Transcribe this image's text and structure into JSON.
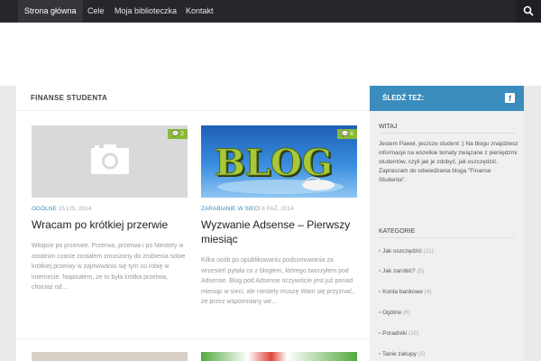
{
  "nav": {
    "items": [
      "Strona główna",
      "Cele",
      "Moja biblioteczka",
      "Kontakt"
    ]
  },
  "page": {
    "title": "FINANSE STUDENTA"
  },
  "posts": [
    {
      "category": "OGÓLNE",
      "date": "15 LIS, 2014",
      "comments": "2",
      "title": "Wracam po krótkiej przerwie",
      "excerpt": "Witajcie po przerwie. Przerwa, przerwa i po Niestety w ostatnim czasie zostałem zmuszony do zrobienia sobie krótkiej przerwy w zajmowaniu się tym co robię w internecie. Napisałem, że to była krótka przerwa, chociaż od…"
    },
    {
      "category": "ZARABIANIE W SIECI",
      "date": "8 PAŹ, 2014",
      "comments": "6",
      "title": "Wyzwanie Adsense – Pierwszy miesiąc",
      "thumb_text": "BLOG",
      "excerpt": "Kilka osób po opublikowaniu podsumowania za wrzesień pytała co z blogiem, którego tworzyłem pod Adsense. Blog pod Adsense oczywiście jest już ponad miesiąc w sieci, ale niestety muszę Wam się przyznać, że przez wspomniany we…"
    }
  ],
  "sidebar": {
    "follow_title": "ŚLEDŹ TEŻ:",
    "about_title": "WITAJ",
    "about_text": "Jestem Paweł, jeszcze student :) Na blogu znajdziesz informacje na wszelkie tematy związane z pieniędzmi studentów, czyli jak je zdobyć, jak oszczędzić. Zapraszam do odwiedzania bloga \"Finanse Studenta\".",
    "categories_title": "KATEGORIE",
    "categories": [
      {
        "name": "Jak oszczędzić",
        "count": "(11)"
      },
      {
        "name": "Jak zarobić?",
        "count": "(5)"
      },
      {
        "name": "Konta bankowe",
        "count": "(4)"
      },
      {
        "name": "Ogólne",
        "count": "(6)"
      },
      {
        "name": "Poradniki",
        "count": "(10)"
      },
      {
        "name": "Tanie zakupy",
        "count": "(5)"
      }
    ]
  },
  "colors": {
    "accent": "#3b8dbd",
    "badge": "#8ab936",
    "nav_bg": "#26272b"
  }
}
